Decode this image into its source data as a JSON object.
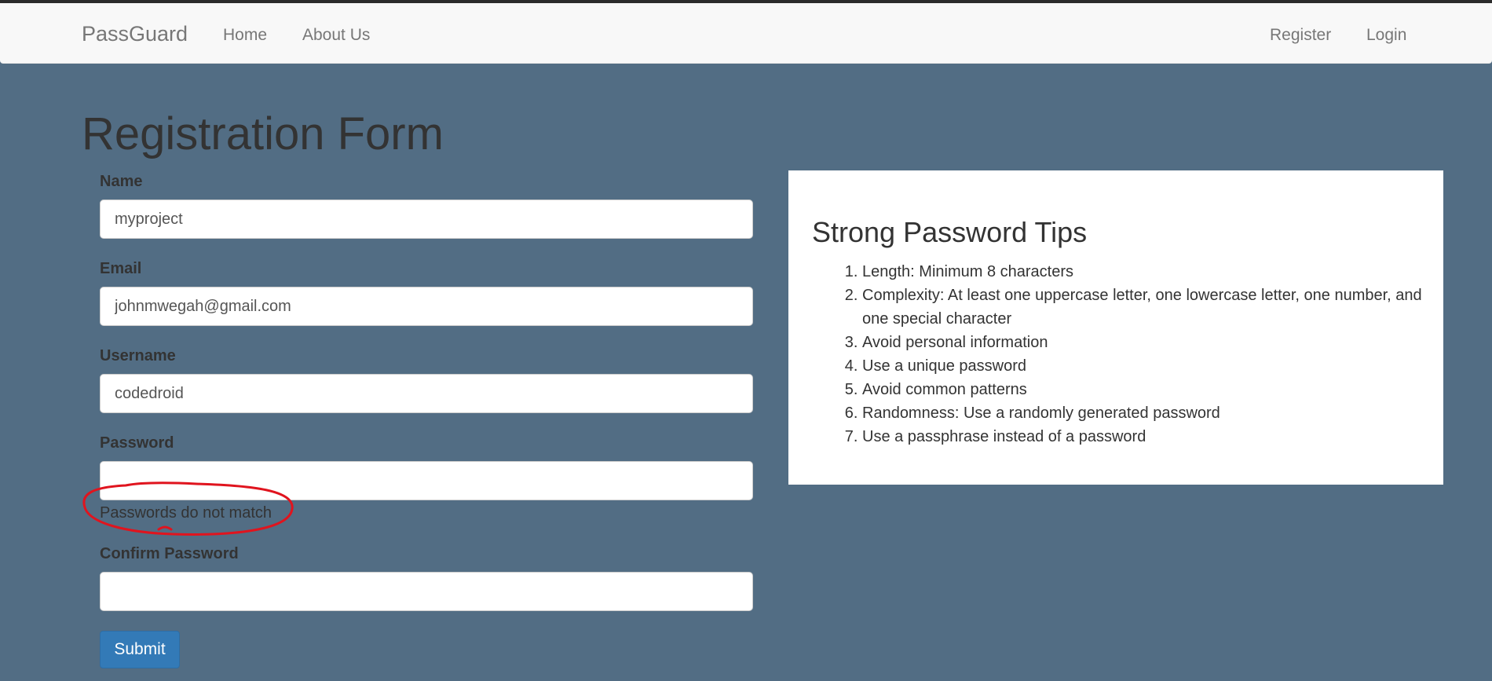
{
  "navbar": {
    "brand": "PassGuard",
    "links_left": [
      "Home",
      "About Us"
    ],
    "links_right": [
      "Register",
      "Login"
    ]
  },
  "page": {
    "title": "Registration Form"
  },
  "form": {
    "fields": [
      {
        "label": "Name",
        "value": "myproject"
      },
      {
        "label": "Email",
        "value": "johnmwegah@gmail.com"
      },
      {
        "label": "Username",
        "value": "codedroid"
      },
      {
        "label": "Password",
        "value": ""
      },
      {
        "label": "Confirm Password",
        "value": ""
      }
    ],
    "error_message": "Passwords do not match",
    "submit_label": "Submit"
  },
  "tips": {
    "title": "Strong Password Tips",
    "items": [
      "Length: Minimum 8 characters",
      "Complexity: At least one uppercase letter, one lowercase letter, one number, and one special character",
      "Avoid personal information",
      "Use a unique password",
      "Avoid common patterns",
      "Randomness: Use a randomly generated password",
      "Use a passphrase instead of a password"
    ]
  },
  "colors": {
    "background": "#526d84",
    "navbar": "#f8f8f8",
    "primary_button": "#337ab7",
    "annotation": "#e0141e"
  }
}
